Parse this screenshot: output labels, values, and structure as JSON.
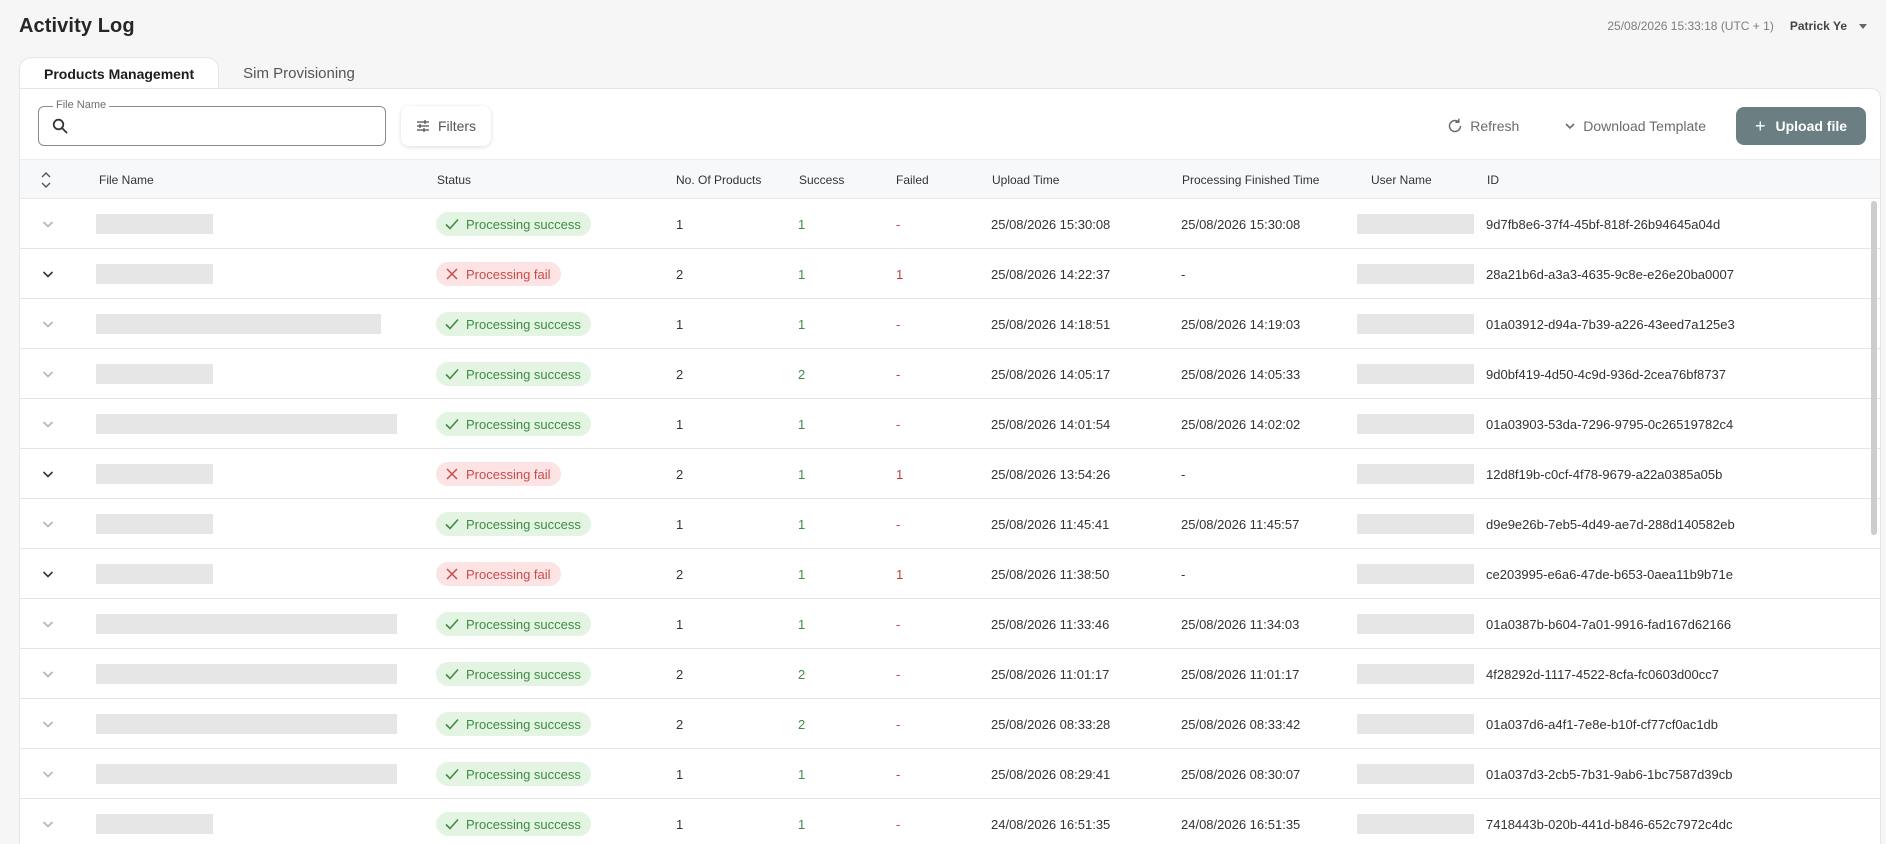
{
  "app": {
    "title": "Activity Log",
    "datetime": "25/08/2026 15:33:18 (UTC + 1)",
    "user_name": "Patrick Ye"
  },
  "tabs": [
    {
      "label": "Products Management",
      "active": true
    },
    {
      "label": "Sim Provisioning",
      "active": false
    }
  ],
  "toolbar": {
    "file_name_label": "File Name",
    "file_name_value": "",
    "filters_label": "Filters",
    "refresh_label": "Refresh",
    "download_label": "Download Template",
    "upload_label": "Upload file"
  },
  "table": {
    "headers": {
      "file_name": "File Name",
      "status": "Status",
      "products": "No. Of Products",
      "success": "Success",
      "failed": "Failed",
      "upload_time": "Upload Time",
      "finished_time": "Processing Finished Time",
      "user_name": "User Name",
      "id": "ID"
    },
    "rows": [
      {
        "expandable": false,
        "file_bar": "short",
        "status": "Processing success",
        "ok": true,
        "products": "1",
        "success": "1",
        "failed": "-",
        "upload": "25/08/2026 15:30:08",
        "finished": "25/08/2026 15:30:08",
        "id": "9d7fb8e6-37f4-45bf-818f-26b94645a04d"
      },
      {
        "expandable": true,
        "file_bar": "short",
        "status": "Processing fail",
        "ok": false,
        "products": "2",
        "success": "1",
        "failed": "1",
        "upload": "25/08/2026 14:22:37",
        "finished": "-",
        "id": "28a21b6d-a3a3-4635-9c8e-e26e20ba0007"
      },
      {
        "expandable": false,
        "file_bar": "long",
        "status": "Processing success",
        "ok": true,
        "products": "1",
        "success": "1",
        "failed": "-",
        "upload": "25/08/2026 14:18:51",
        "finished": "25/08/2026 14:19:03",
        "id": "01a03912-d94a-7b39-a226-43eed7a125e3"
      },
      {
        "expandable": false,
        "file_bar": "short",
        "status": "Processing success",
        "ok": true,
        "products": "2",
        "success": "2",
        "failed": "-",
        "upload": "25/08/2026 14:05:17",
        "finished": "25/08/2026 14:05:33",
        "id": "9d0bf419-4d50-4c9d-936d-2cea76bf8737"
      },
      {
        "expandable": false,
        "file_bar": "xlong",
        "status": "Processing success",
        "ok": true,
        "products": "1",
        "success": "1",
        "failed": "-",
        "upload": "25/08/2026 14:01:54",
        "finished": "25/08/2026 14:02:02",
        "id": "01a03903-53da-7296-9795-0c26519782c4"
      },
      {
        "expandable": true,
        "file_bar": "short",
        "status": "Processing fail",
        "ok": false,
        "products": "2",
        "success": "1",
        "failed": "1",
        "upload": "25/08/2026 13:54:26",
        "finished": "-",
        "id": "12d8f19b-c0cf-4f78-9679-a22a0385a05b"
      },
      {
        "expandable": false,
        "file_bar": "short",
        "status": "Processing success",
        "ok": true,
        "products": "1",
        "success": "1",
        "failed": "-",
        "upload": "25/08/2026 11:45:41",
        "finished": "25/08/2026 11:45:57",
        "id": "d9e9e26b-7eb5-4d49-ae7d-288d140582eb"
      },
      {
        "expandable": true,
        "file_bar": "short",
        "status": "Processing fail",
        "ok": false,
        "products": "2",
        "success": "1",
        "failed": "1",
        "upload": "25/08/2026 11:38:50",
        "finished": "-",
        "id": "ce203995-e6a6-47de-b653-0aea11b9b71e"
      },
      {
        "expandable": false,
        "file_bar": "xlong",
        "status": "Processing success",
        "ok": true,
        "products": "1",
        "success": "1",
        "failed": "-",
        "upload": "25/08/2026 11:33:46",
        "finished": "25/08/2026 11:34:03",
        "id": "01a0387b-b604-7a01-9916-fad167d62166"
      },
      {
        "expandable": false,
        "file_bar": "xlong",
        "status": "Processing success",
        "ok": true,
        "products": "2",
        "success": "2",
        "failed": "-",
        "upload": "25/08/2026 11:01:17",
        "finished": "25/08/2026 11:01:17",
        "id": "4f28292d-1117-4522-8cfa-fc0603d00cc7"
      },
      {
        "expandable": false,
        "file_bar": "xlong",
        "status": "Processing success",
        "ok": true,
        "products": "2",
        "success": "2",
        "failed": "-",
        "upload": "25/08/2026 08:33:28",
        "finished": "25/08/2026 08:33:42",
        "id": "01a037d6-a4f1-7e8e-b10f-cf77cf0ac1db"
      },
      {
        "expandable": false,
        "file_bar": "xlong",
        "status": "Processing success",
        "ok": true,
        "products": "1",
        "success": "1",
        "failed": "-",
        "upload": "25/08/2026 08:29:41",
        "finished": "25/08/2026 08:30:07",
        "id": "01a037d3-2cb5-7b31-9ab6-1bc7587d39cb"
      },
      {
        "expandable": false,
        "file_bar": "short",
        "status": "Processing success",
        "ok": true,
        "products": "1",
        "success": "1",
        "failed": "-",
        "upload": "24/08/2026 16:51:35",
        "finished": "24/08/2026 16:51:35",
        "id": "7418443b-020b-441d-b846-652c7972c4dc"
      }
    ]
  },
  "colors": {
    "success": "#3e8d43",
    "success_bg": "#e3f4e2",
    "fail": "#c94b4b",
    "fail_bg": "#fde3e3",
    "primary_button": "#6b7f83"
  },
  "icons": {
    "search": "search-icon",
    "filters": "filters-icon",
    "refresh": "refresh-icon",
    "download": "chevron-down-icon",
    "upload": "plus-icon",
    "sort": "sort-icon",
    "expand": "chevron-down-icon",
    "success": "check-icon",
    "fail": "cross-icon"
  }
}
